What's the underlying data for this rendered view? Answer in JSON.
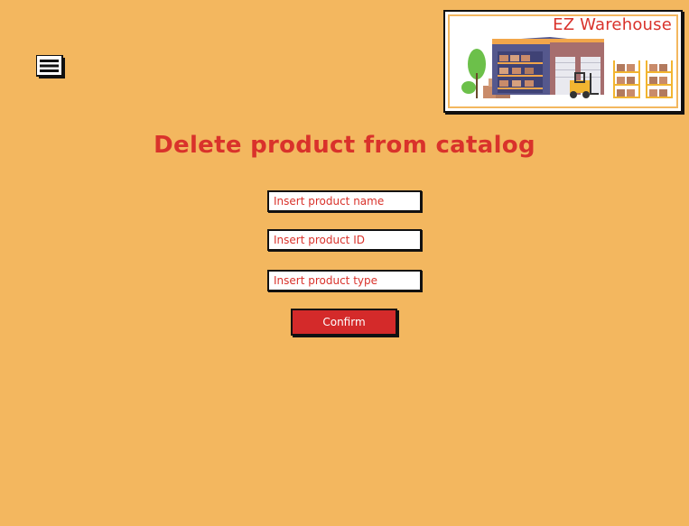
{
  "header": {
    "menu_icon": "hamburger-menu-icon",
    "logo": {
      "title": "EZ Warehouse",
      "image": "warehouse-illustration",
      "colors": {
        "title": "#d9322b",
        "border": "#111111"
      }
    }
  },
  "main": {
    "title": "Delete product from catalog",
    "fields": {
      "product_name": {
        "placeholder": "Insert product name",
        "value": ""
      },
      "product_id": {
        "placeholder": "Insert product ID",
        "value": ""
      },
      "product_type": {
        "placeholder": "Insert product type",
        "value": ""
      }
    },
    "confirm_label": "Confirm"
  },
  "theme": {
    "background": "#f3b75f",
    "accent": "#d9322b",
    "button": "#d42a2a",
    "button_text": "#ffffff"
  }
}
